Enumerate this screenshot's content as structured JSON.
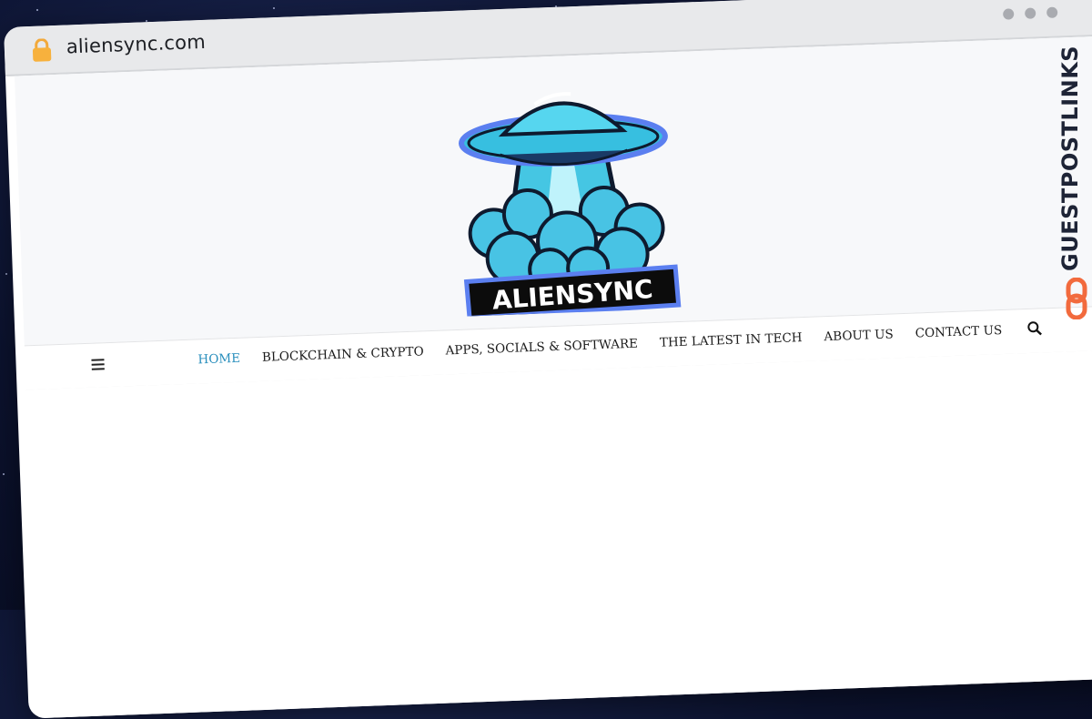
{
  "browser": {
    "url": "aliensync.com"
  },
  "site": {
    "logo_text": "ALIENSYNC",
    "nav": [
      {
        "label": "HOME",
        "active": true
      },
      {
        "label": "BLOCKCHAIN & CRYPTO",
        "active": false
      },
      {
        "label": "APPS, SOCIALS & SOFTWARE",
        "active": false
      },
      {
        "label": "THE LATEST IN TECH",
        "active": false
      },
      {
        "label": "ABOUT US",
        "active": false
      },
      {
        "label": "CONTACT US",
        "active": false
      }
    ],
    "icons": {
      "menu": "hamburger-menu-icon",
      "search": "search-icon"
    }
  },
  "watermark": {
    "text": "GUESTPOSTLINKS",
    "icon": "chain-link-icon"
  },
  "colors": {
    "accent": "#2a8fbd",
    "logo_cyan": "#38c9e6",
    "logo_outline": "#5b7ff0",
    "watermark_orange": "#f26a3d"
  }
}
